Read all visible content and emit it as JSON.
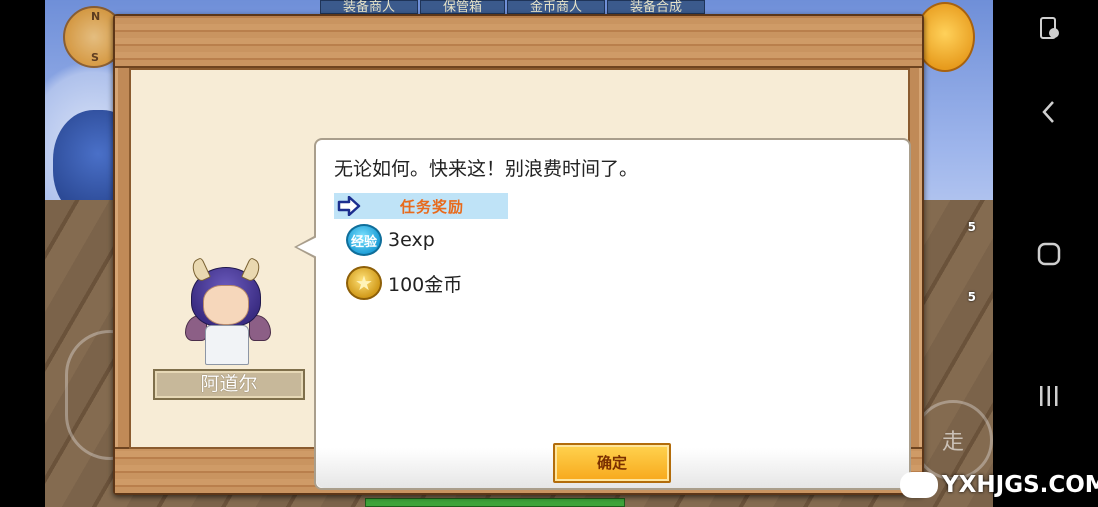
{
  "game": {
    "top_tabs": [
      "装备商人",
      "保管箱",
      "金币商人",
      "装备合成"
    ],
    "compass": {
      "north": "N",
      "south": "S"
    },
    "right_slots": [
      {
        "count": "5"
      },
      {
        "count": "5"
      }
    ],
    "attack_label": "走"
  },
  "dialog": {
    "npc_name": "阿道尔",
    "message": "无论如何。快来这！别浪费时间了。",
    "reward_title": "任务奖励",
    "rewards": [
      {
        "icon": "exp-icon",
        "icon_label": "经验",
        "value": "3exp"
      },
      {
        "icon": "coin-icon",
        "icon_label": "★",
        "value": "100金币"
      }
    ],
    "confirm_label": "确定"
  },
  "watermark": "YXHJGS.COM",
  "colors": {
    "wood": "#c08a57",
    "parchment": "#f7ecd6",
    "reward_header_bg": "#bfe3f7",
    "reward_title": "#e86a1c",
    "confirm_bg": "#f7a81c"
  }
}
